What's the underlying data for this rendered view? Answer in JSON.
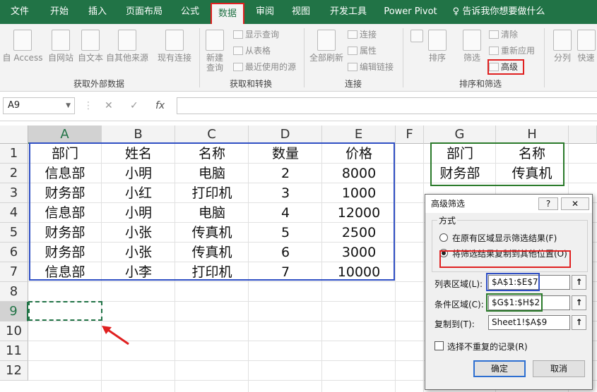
{
  "tabs": [
    "文件",
    "开始",
    "插入",
    "页面布局",
    "公式",
    "数据",
    "审阅",
    "视图",
    "开发工具",
    "Power Pivot",
    "告诉我你想要做什么"
  ],
  "ribbon": {
    "get_external": {
      "from_access": "自 Access",
      "from_web": "自网站",
      "from_text": "自文本",
      "from_other": "自其他来源",
      "existing": "现有连接",
      "label": "获取外部数据"
    },
    "get_transform": {
      "new_query_1": "新建",
      "new_query_2": "查询",
      "show_query": "显示查询",
      "from_table": "从表格",
      "recent": "最近使用的源",
      "label": "获取和转换"
    },
    "connections": {
      "refresh_all": "全部刷新",
      "connections": "连接",
      "properties": "属性",
      "edit_links": "编辑链接",
      "label": "连接"
    },
    "sort_filter": {
      "sort": "排序",
      "filter": "筛选",
      "clear": "清除",
      "reapply": "重新应用",
      "advanced": "高级",
      "label": "排序和筛选"
    },
    "data_tools": {
      "split": "分列",
      "quick": "快速"
    }
  },
  "formula_bar": {
    "name_box": "A9",
    "cancel": "✕",
    "enter": "✓",
    "fx": "fx",
    "value": ""
  },
  "columns": [
    "A",
    "B",
    "C",
    "D",
    "E",
    "F",
    "G",
    "H"
  ],
  "rows": [
    "1",
    "2",
    "3",
    "4",
    "5",
    "6",
    "7",
    "8",
    "9",
    "10",
    "11",
    "12"
  ],
  "table": {
    "headers": [
      "部门",
      "姓名",
      "名称",
      "数量",
      "价格"
    ],
    "rows": [
      [
        "信息部",
        "小明",
        "电脑",
        "2",
        "8000"
      ],
      [
        "财务部",
        "小红",
        "打印机",
        "3",
        "1000"
      ],
      [
        "信息部",
        "小明",
        "电脑",
        "4",
        "12000"
      ],
      [
        "财务部",
        "小张",
        "传真机",
        "5",
        "2500"
      ],
      [
        "财务部",
        "小张",
        "传真机",
        "6",
        "3000"
      ],
      [
        "信息部",
        "小李",
        "打印机",
        "7",
        "10000"
      ]
    ]
  },
  "criteria": {
    "headers": [
      "部门",
      "名称"
    ],
    "values": [
      "财务部",
      "传真机"
    ]
  },
  "dialog": {
    "title": "高级筛选",
    "help": "?",
    "close": "✕",
    "method_label": "方式",
    "option_in_place": "在原有区域显示筛选结果(F)",
    "option_copy": "将筛选结果复制到其他位置(O)",
    "list_range_label": "列表区域(L):",
    "list_range_value": "$A$1:$E$7",
    "criteria_range_label": "条件区域(C):",
    "criteria_range_value": "$G$1:$H$2",
    "copy_to_label": "复制到(T):",
    "copy_to_value": "Sheet1!$A$9",
    "unique_label": "选择不重复的记录(R)",
    "picker": "↑",
    "ok": "确定",
    "cancel": "取消"
  },
  "colors": {
    "excel_green": "#217346",
    "highlight_red": "#e02020",
    "table_blue": "#2f4fc4",
    "criteria_green": "#2a7a2a"
  }
}
